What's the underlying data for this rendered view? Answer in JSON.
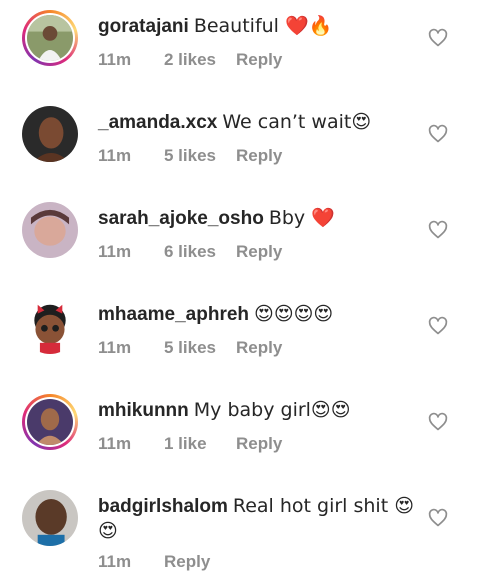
{
  "comments": [
    {
      "username": "goratajani",
      "text": "Beautiful ❤️🔥",
      "time": "11m",
      "likes": "2 likes",
      "reply": "Reply",
      "story_ring": true
    },
    {
      "username": "_amanda.xcx",
      "text": "We can’t wait😍",
      "time": "11m",
      "likes": "5 likes",
      "reply": "Reply",
      "story_ring": false
    },
    {
      "username": "sarah_ajoke_osho",
      "text": "Bby ❤️",
      "time": "11m",
      "likes": "6 likes",
      "reply": "Reply",
      "story_ring": false
    },
    {
      "username": "mhaame_aphreh",
      "text": "😍😍😍😍",
      "time": "11m",
      "likes": "5 likes",
      "reply": "Reply",
      "story_ring": false
    },
    {
      "username": "mhikunnn",
      "text": "My baby girl😍😍",
      "time": "11m",
      "likes": "1 like",
      "reply": "Reply",
      "story_ring": true
    },
    {
      "username": "badgirlshalom",
      "text": "Real hot girl shit 😍😍",
      "time": "11m",
      "likes": "",
      "reply": "Reply",
      "story_ring": false
    }
  ],
  "colors": {
    "text": "#262626",
    "meta": "#8e8e8e",
    "heart_outline": "#8e8e8e"
  },
  "icons": {
    "like": "heart-outline-icon"
  }
}
